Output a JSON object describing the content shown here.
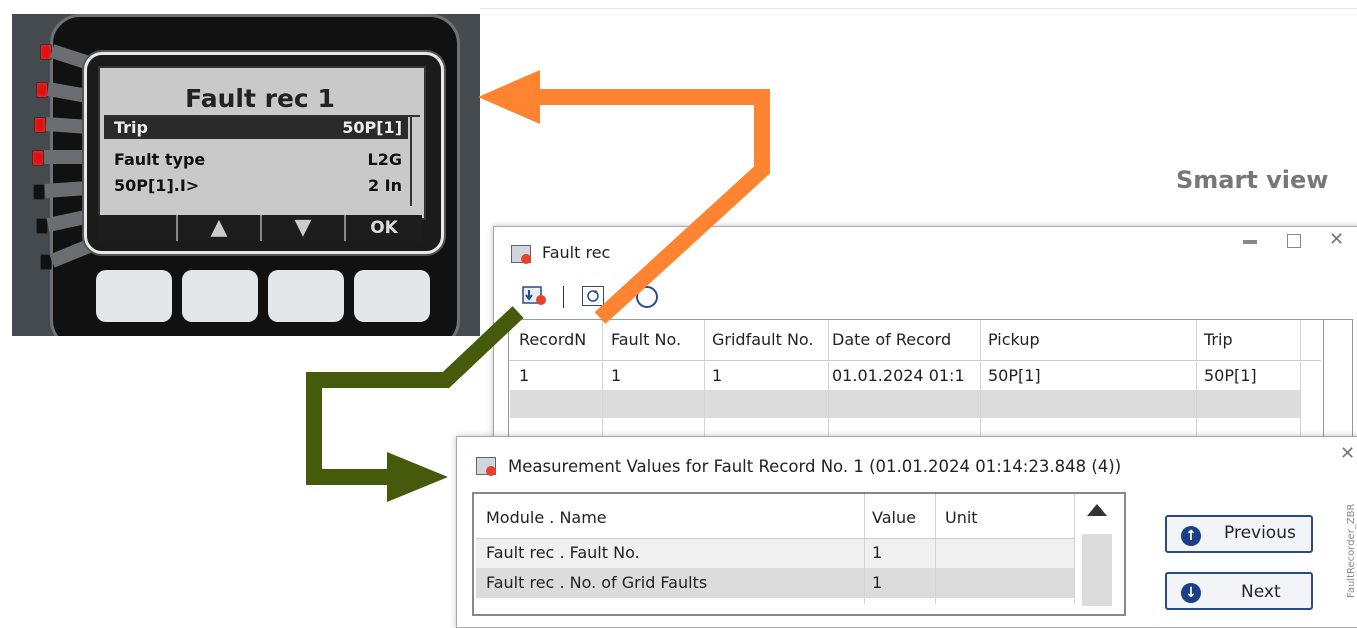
{
  "device": {
    "lcd_title": "Fault rec 1",
    "rows": [
      {
        "label": "Trip",
        "value": "50P[1]",
        "selected": true
      },
      {
        "label": "Fault type",
        "value": "L2G",
        "selected": false
      },
      {
        "label": "50P[1].I>",
        "value": "2 In",
        "selected": false
      }
    ],
    "softkeys": [
      "",
      "▲",
      "▼",
      "OK"
    ]
  },
  "smart_view_label": "Smart view",
  "fault_window": {
    "title": "Fault rec",
    "columns": [
      "RecordN",
      "Fault No.",
      "Gridfault No.",
      "Date of Record",
      "Pickup",
      "Trip"
    ],
    "rows": [
      [
        "1",
        "1",
        "1",
        "01.01.2024 01:1",
        "50P[1]",
        "50P[1]"
      ]
    ]
  },
  "measure_window": {
    "title": "Measurement Values for Fault Record No. 1 (01.01.2024 01:14:23.848 (4))",
    "columns": [
      "Module . Name",
      "Value",
      "Unit"
    ],
    "rows": [
      [
        "Fault rec . Fault No.",
        "1",
        ""
      ],
      [
        "Fault rec . No. of Grid Faults",
        "1",
        ""
      ]
    ],
    "previous_label": "Previous",
    "next_label": "Next"
  },
  "side_caption": "FaultRecorder_ZBR",
  "colors": {
    "orange_arrow": "#ff8432",
    "green_arrow": "#455a0a"
  }
}
